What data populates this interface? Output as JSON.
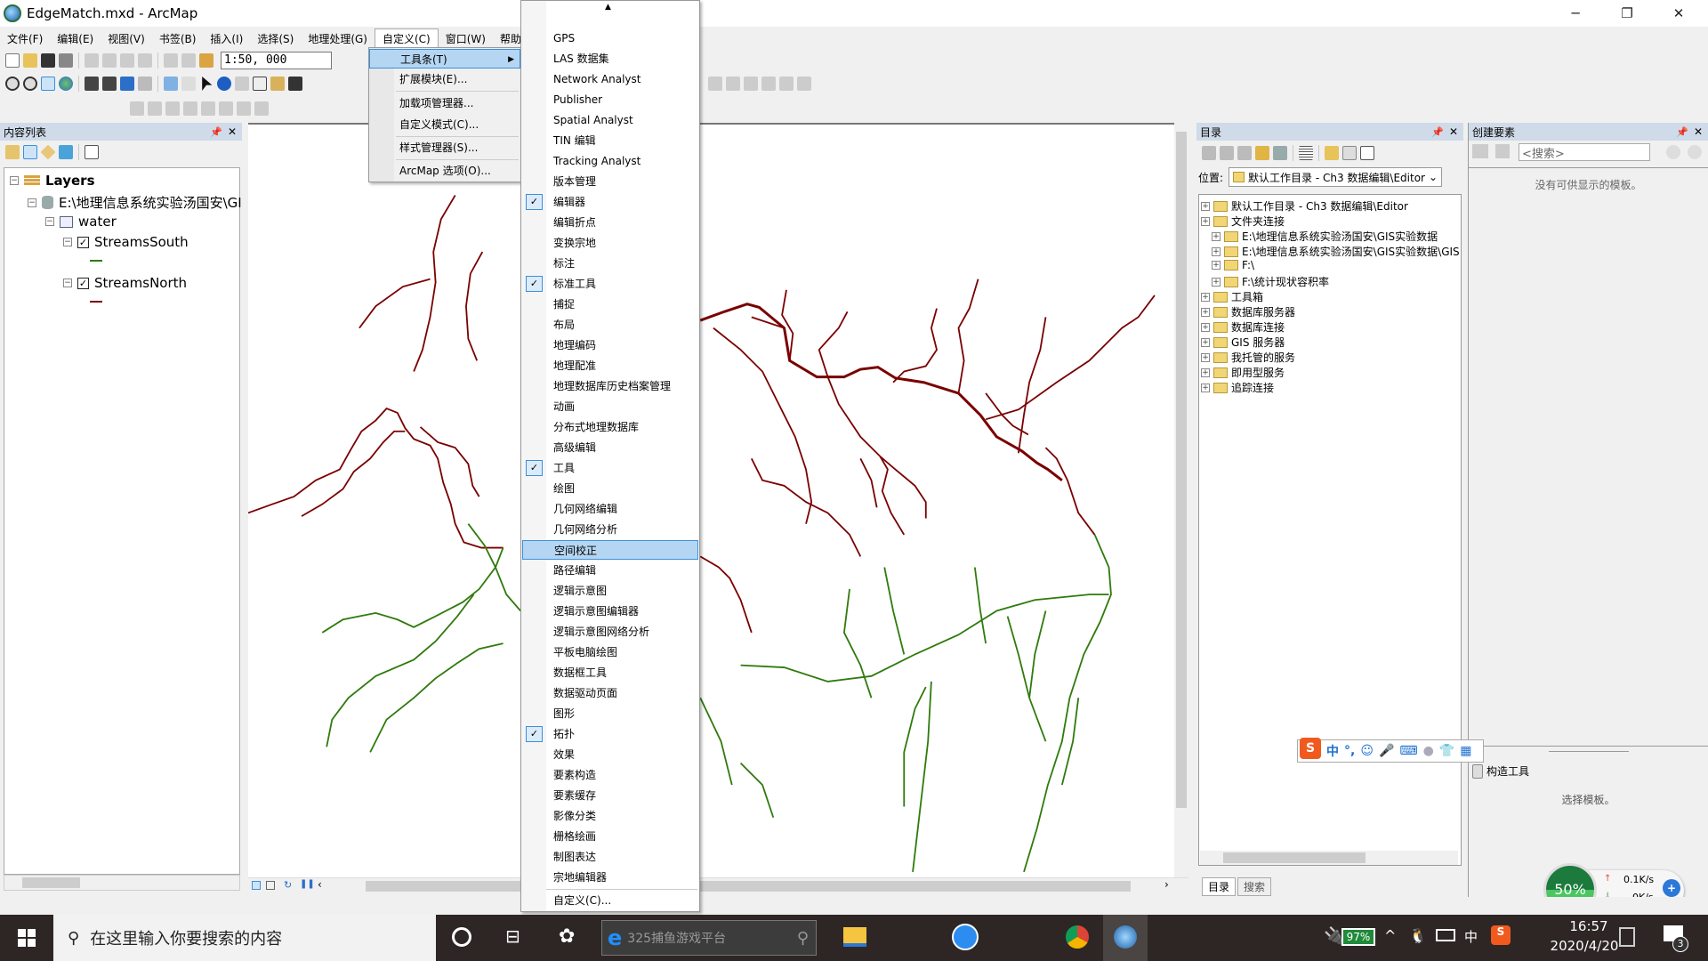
{
  "window": {
    "title": "EdgeMatch.mxd - ArcMap",
    "minimize": "─",
    "restore": "❐",
    "close": "✕"
  },
  "menubar": [
    "文件(F)",
    "编辑(E)",
    "视图(V)",
    "书签(B)",
    "插入(I)",
    "选择(S)",
    "地理处理(G)",
    "自定义(C)",
    "窗口(W)",
    "帮助(H)"
  ],
  "toolbar": {
    "scale": "1:50, 000"
  },
  "toc": {
    "title": "内容列表",
    "root": "Layers",
    "datasource": "E:\\地理信息系统实验汤国安\\GI",
    "group": "water",
    "layers": [
      {
        "name": "StreamsSouth",
        "color": "#2f7a0c",
        "checked": true
      },
      {
        "name": "StreamsNorth",
        "color": "#7a0000",
        "checked": true
      }
    ]
  },
  "customize_menu": {
    "items": [
      "工具条(T)",
      "扩展模块(E)...",
      "加载项管理器...",
      "自定义模式(C)...",
      "样式管理器(S)...",
      "ArcMap 选项(O)..."
    ],
    "highlighted": "工具条(T)"
  },
  "toolbars_submenu": {
    "items": [
      {
        "label": "GPS",
        "checked": false
      },
      {
        "label": "LAS 数据集",
        "checked": false
      },
      {
        "label": "Network Analyst",
        "checked": false
      },
      {
        "label": "Publisher",
        "checked": false
      },
      {
        "label": "Spatial Analyst",
        "checked": false
      },
      {
        "label": "TIN 编辑",
        "checked": false
      },
      {
        "label": "Tracking Analyst",
        "checked": false
      },
      {
        "label": "版本管理",
        "checked": false
      },
      {
        "label": "编辑器",
        "checked": true
      },
      {
        "label": "编辑折点",
        "checked": false
      },
      {
        "label": "变换宗地",
        "checked": false
      },
      {
        "label": "标注",
        "checked": false
      },
      {
        "label": "标准工具",
        "checked": true
      },
      {
        "label": "捕捉",
        "checked": false
      },
      {
        "label": "布局",
        "checked": false
      },
      {
        "label": "地理编码",
        "checked": false
      },
      {
        "label": "地理配准",
        "checked": false
      },
      {
        "label": "地理数据库历史档案管理",
        "checked": false
      },
      {
        "label": "动画",
        "checked": false
      },
      {
        "label": "分布式地理数据库",
        "checked": false
      },
      {
        "label": "高级编辑",
        "checked": false
      },
      {
        "label": "工具",
        "checked": true
      },
      {
        "label": "绘图",
        "checked": false
      },
      {
        "label": "几何网络编辑",
        "checked": false
      },
      {
        "label": "几何网络分析",
        "checked": false
      },
      {
        "label": "空间校正",
        "checked": false,
        "highlighted": true
      },
      {
        "label": "路径编辑",
        "checked": false
      },
      {
        "label": "逻辑示意图",
        "checked": false
      },
      {
        "label": "逻辑示意图编辑器",
        "checked": false
      },
      {
        "label": "逻辑示意图网络分析",
        "checked": false
      },
      {
        "label": "平板电脑绘图",
        "checked": false
      },
      {
        "label": "数据框工具",
        "checked": false
      },
      {
        "label": "数据驱动页面",
        "checked": false
      },
      {
        "label": "图形",
        "checked": false
      },
      {
        "label": "拓扑",
        "checked": true
      },
      {
        "label": "效果",
        "checked": false
      },
      {
        "label": "要素构造",
        "checked": false
      },
      {
        "label": "要素缓存",
        "checked": false
      },
      {
        "label": "影像分类",
        "checked": false
      },
      {
        "label": "栅格绘画",
        "checked": false
      },
      {
        "label": "制图表达",
        "checked": false
      },
      {
        "label": "宗地编辑器",
        "checked": false
      }
    ],
    "footer": "自定义(C)..."
  },
  "catalog": {
    "title": "目录",
    "location_label": "位置:",
    "location_value": "默认工作目录 - Ch3 数据编辑\\Editor",
    "tree": [
      {
        "label": "默认工作目录 - Ch3 数据编辑\\Editor",
        "level": 0
      },
      {
        "label": "文件夹连接",
        "level": 0
      },
      {
        "label": "E:\\地理信息系统实验汤国安\\GIS实验数据",
        "level": 1
      },
      {
        "label": "E:\\地理信息系统实验汤国安\\GIS实验数据\\GIS",
        "level": 1
      },
      {
        "label": "F:\\",
        "level": 1
      },
      {
        "label": "F:\\统计现状容积率",
        "level": 1
      },
      {
        "label": "工具箱",
        "level": 0
      },
      {
        "label": "数据库服务器",
        "level": 0
      },
      {
        "label": "数据库连接",
        "level": 0
      },
      {
        "label": "GIS 服务器",
        "level": 0
      },
      {
        "label": "我托管的服务",
        "level": 0
      },
      {
        "label": "即用型服务",
        "level": 0
      },
      {
        "label": "追踪连接",
        "level": 0
      }
    ],
    "tabs": [
      "目录",
      "搜索"
    ]
  },
  "create_features": {
    "title": "创建要素",
    "search_placeholder": "<搜索>",
    "empty_msg": "没有可供显示的模板。",
    "tools_title": "构造工具",
    "tools_msg": "选择模板。"
  },
  "ime": {
    "mode": "中",
    "punct": "°,"
  },
  "network_widget": {
    "percent": "50%",
    "up": "0.1K/s",
    "down": "0K/s"
  },
  "taskbar": {
    "search_placeholder": "在这里输入你要搜索的内容",
    "edge_text": "325捕鱼游戏平台",
    "battery": "97%",
    "ime": "中",
    "time": "16:57",
    "date": "2020/4/20",
    "notifications": "3"
  },
  "colors": {
    "north": "#7a0000",
    "south": "#2f7a0c",
    "highlight": "#b5d6f2",
    "panel_header": "#cfdbe8"
  }
}
